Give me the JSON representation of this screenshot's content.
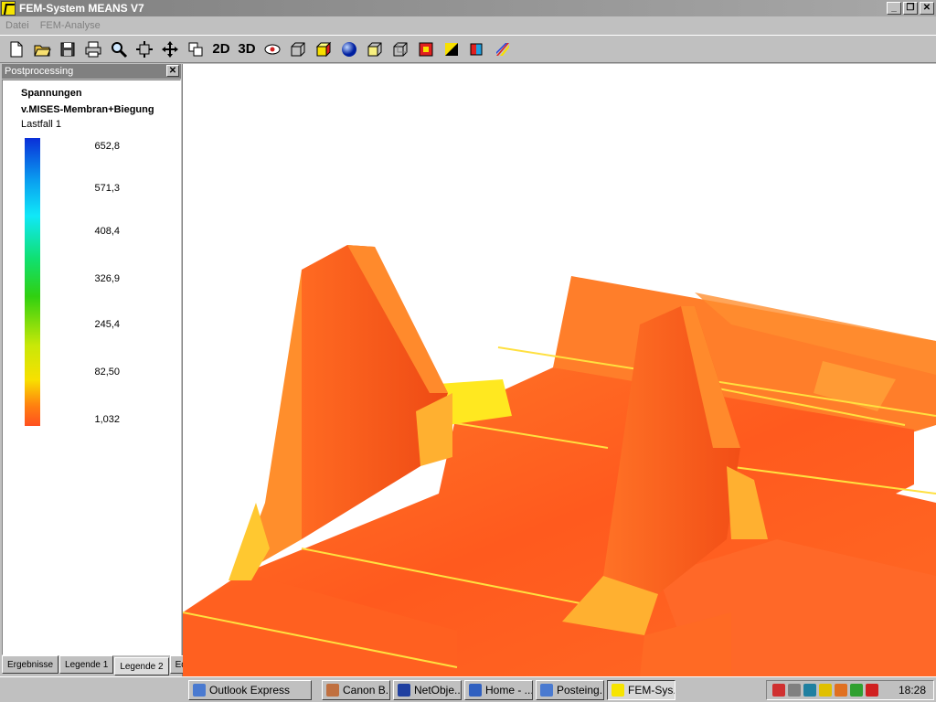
{
  "window": {
    "title": "FEM-System MEANS V7",
    "minimize": "_",
    "restore": "❐",
    "close": "✕"
  },
  "menu": {
    "items": [
      "Datei",
      "FEM-Analyse"
    ]
  },
  "toolbar": {
    "label_2d": "2D",
    "label_3d": "3D"
  },
  "panel": {
    "title": "Postprocessing",
    "close": "✕",
    "legend_title": "Spannungen",
    "legend_subtitle": "v.MISES-Membran+Biegung",
    "load_case": "Lastfall  1",
    "scale_values": [
      "652,8",
      "571,3",
      "408,4",
      "326,9",
      "245,4",
      "82,50",
      "1,032"
    ],
    "tabs": [
      "Ergebnisse",
      "Legende 1",
      "Legende 2",
      "Edit"
    ],
    "active_tab": "Legende 2"
  },
  "taskbar": {
    "tasks": [
      "Outlook Express",
      "Canon B...",
      "NetObje...",
      "Home - ...",
      "Posteing...",
      "FEM-Sys..."
    ],
    "active_task": "FEM-Sys...",
    "clock": "18:28"
  },
  "colors": {
    "accent": "#808080",
    "stress_low": "#ff5020",
    "stress_mid": "#f8e000",
    "stress_high": "#0a2fd8"
  }
}
